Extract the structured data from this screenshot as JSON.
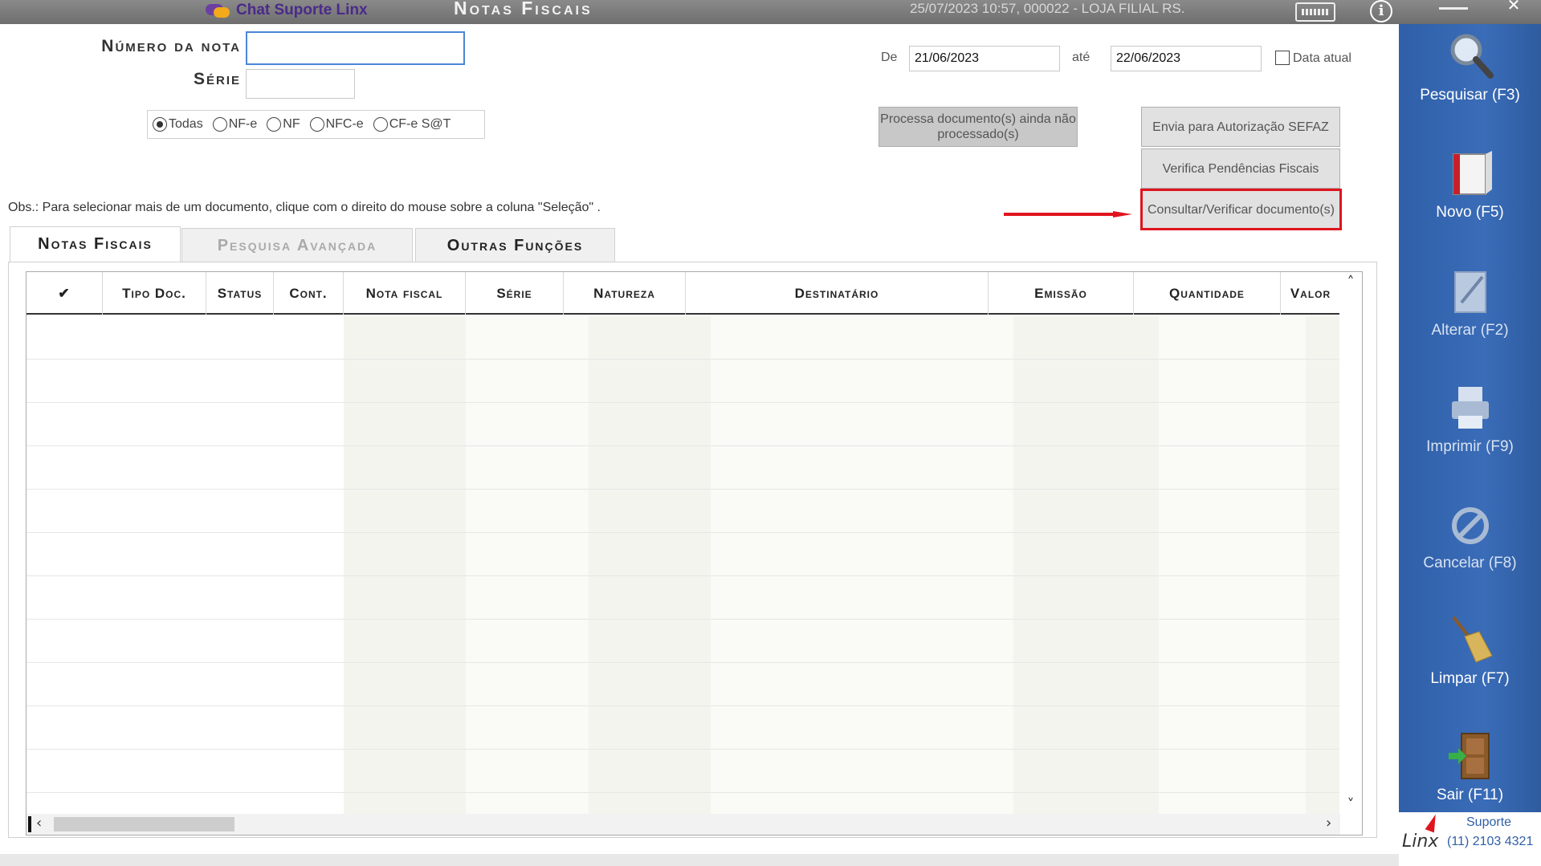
{
  "titlebar": {
    "chat_label": "Chat Suporte Linx",
    "app_title": "Notas Fiscais",
    "status": "25/07/2023 10:57, 000022 - LOJA FILIAL RS.",
    "close_glyph": "✕"
  },
  "filters": {
    "numero_label": "Número da nota",
    "numero_value": "",
    "serie_label": "Série",
    "serie_value": "",
    "de_label": "De",
    "de_value": "21/06/2023",
    "ate_label": "até",
    "ate_value": "22/06/2023",
    "data_atual_label": "Data atual",
    "data_atual_checked": false,
    "doc_types": [
      {
        "label": "Todas",
        "selected": true
      },
      {
        "label": "NF-e",
        "selected": false
      },
      {
        "label": "NF",
        "selected": false
      },
      {
        "label": "NFC-e",
        "selected": false
      },
      {
        "label": "CF-e S@T",
        "selected": false
      }
    ]
  },
  "actions": {
    "processa_line1": "Processa documento(s) ainda não",
    "processa_line2": "processado(s)",
    "envia": "Envia para Autorização SEFAZ",
    "verifica": "Verifica Pendências Fiscais",
    "consultar": "Consultar/Verificar documento(s)"
  },
  "obs": "Obs.: Para selecionar mais de um documento, clique com o direito do mouse sobre a coluna \"Seleção\" .",
  "tabs": [
    {
      "label": "Notas Fiscais",
      "active": true
    },
    {
      "label": "Pesquisa Avançada",
      "active": false
    },
    {
      "label": "Outras Funções",
      "active": false
    }
  ],
  "grid": {
    "columns": [
      "✔",
      "Tipo Doc.",
      "Status",
      "Cont.",
      "Nota fiscal",
      "Série",
      "Natureza",
      "Destinatário",
      "Emissão",
      "Quantidade",
      "Valor"
    ],
    "rows": []
  },
  "sidebar": {
    "items": [
      {
        "label": "Pesquisar (F3)",
        "icon": "magnifier-icon",
        "enabled": true
      },
      {
        "label": "Novo (F5)",
        "icon": "new-document-icon",
        "enabled": true
      },
      {
        "label": "Alterar (F2)",
        "icon": "edit-document-icon",
        "enabled": false
      },
      {
        "label": "Imprimir (F9)",
        "icon": "printer-icon",
        "enabled": false
      },
      {
        "label": "Cancelar (F8)",
        "icon": "cancel-icon",
        "enabled": false
      },
      {
        "label": "Limpar (F7)",
        "icon": "broom-icon",
        "enabled": true
      },
      {
        "label": "Sair (F11)",
        "icon": "exit-door-icon",
        "enabled": true
      }
    ],
    "support_title": "Suporte",
    "support_phone": "(11) 2103 4321",
    "logo_text": "Linx"
  },
  "colors": {
    "sidebar": "#3a6cb8",
    "highlight": "#e0141e",
    "focus_border": "#4a86d8"
  }
}
